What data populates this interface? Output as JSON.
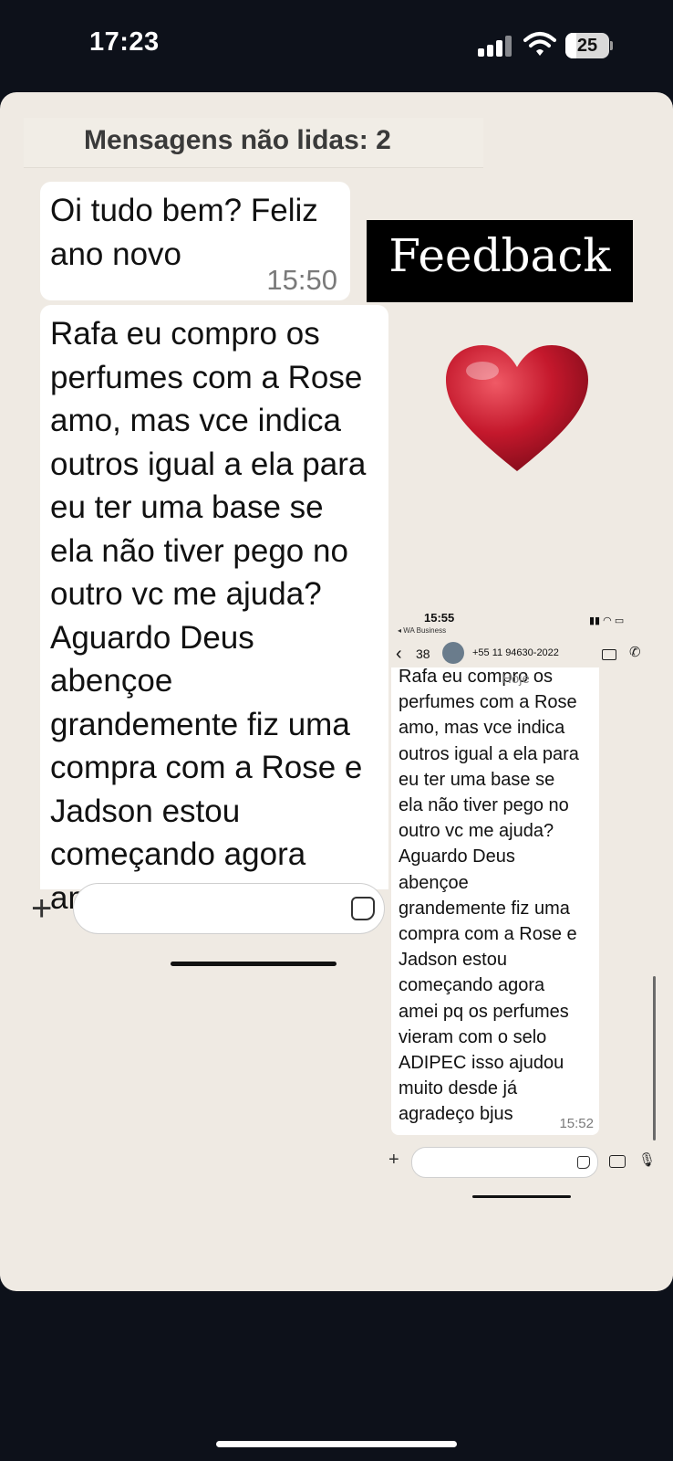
{
  "status_bar": {
    "time": "17:23",
    "battery": "25",
    "battery_level": 0.25
  },
  "chat": {
    "unread_label": "Mensagens não lidas: 2",
    "messages": [
      {
        "text": "Oi tudo bem? Feliz ano novo",
        "time": "15:50"
      },
      {
        "text": "Rafa eu compro os\nperfumes com a Rose\namo, mas vce indica\noutros igual a ela para\neu ter uma base se\nela não tiver pego no\noutro vc me ajuda?\nAguardo Deus\nabençoe\ngrandemente fiz uma\ncompra com a Rose e\nJadson estou\ncomeçando agora\namei pq os perfumes"
      }
    ]
  },
  "overlay": {
    "feedback_label": "Feedback",
    "heart": "heart-emoji"
  },
  "composer": {
    "plus": "+",
    "placeholder": ""
  },
  "mini_screenshot": {
    "time": "15:55",
    "back_app": "◂ WA Business",
    "back_count": "38",
    "contact": "+55 11 94630-2022",
    "date_chip": "Hoje",
    "message_text": "Rafa eu compro os\nperfumes com a Rose\namo, mas vce indica\noutros igual a ela para\neu ter uma base se\nela não tiver pego no\noutro vc me ajuda?\nAguardo Deus\nabençoe\ngrandemente fiz uma\ncompra com a Rose e\nJadson estou\ncomeçando agora\namei pq os perfumes\nvieram com o selo\nADIPEC isso ajudou\nmuito desde já\nagradeço bjus",
    "message_time": "15:52",
    "plus": "+"
  },
  "colors": {
    "chat_bg": "#efeae3",
    "bubble": "#ffffff",
    "page_bg": "#0d111a",
    "heart": "#c4182c"
  }
}
